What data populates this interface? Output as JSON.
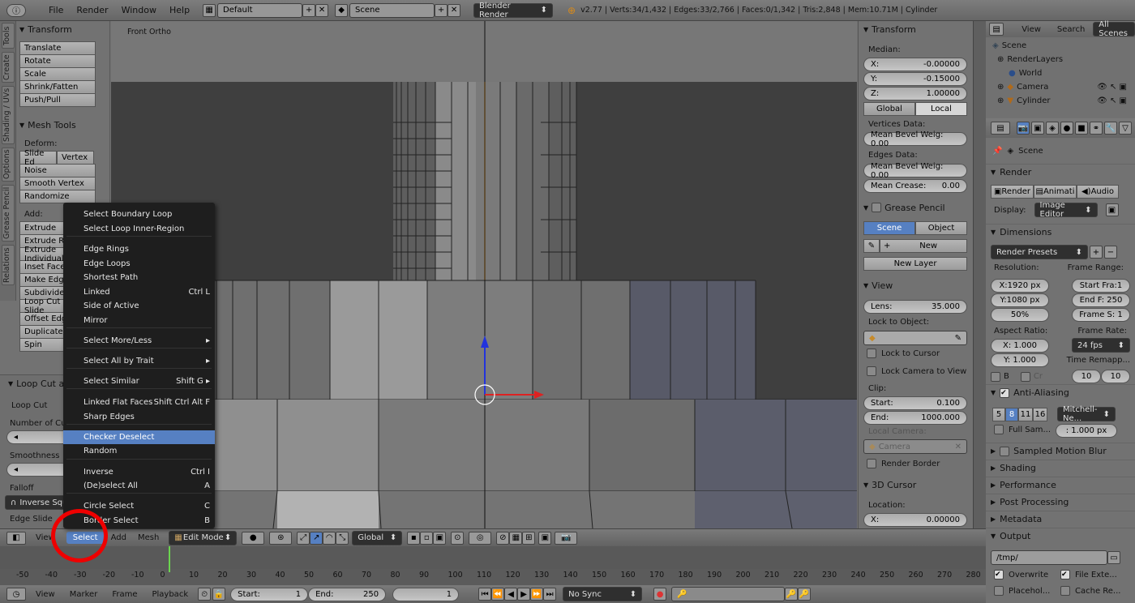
{
  "topbar": {
    "menus": [
      "File",
      "Render",
      "Window",
      "Help"
    ],
    "layout": "Default",
    "scene": "Scene",
    "engine": "Blender Render",
    "stats": "v2.77 | Verts:34/1,432 | Edges:33/2,766 | Faces:0/1,342 | Tris:2,848 | Mem:10.71M | Cylinder"
  },
  "toolshelf": {
    "tabs": [
      "Tools",
      "Create",
      "Shading / UVs",
      "Options",
      "Grease Pencil",
      "Relations"
    ],
    "transform": {
      "title": "Transform",
      "buttons": [
        "Translate",
        "Rotate",
        "Scale",
        "Shrink/Fatten",
        "Push/Pull"
      ]
    },
    "meshtools": {
      "title": "Mesh Tools",
      "deform": "Deform:",
      "slide_ed": "Slide Ed",
      "vertex": "Vertex",
      "noise": "Noise",
      "smooth": "Smooth Vertex",
      "randomize": "Randomize",
      "add": "Add:",
      "add_buttons": [
        "Extrude",
        "Extrude Region",
        "Extrude Individual",
        "Inset Faces",
        "Make Edge/Face",
        "Subdivide",
        "Loop Cut and Slide",
        "Offset Edge Slide",
        "Duplicate",
        "Spin"
      ]
    },
    "operator": {
      "title": "Loop Cut and Slide",
      "loop_cut": "Loop Cut",
      "number_of_cuts": "Number of Cuts",
      "smoothness": "Smoothness",
      "falloff": "Falloff",
      "falloff_value": "Inverse Square",
      "edge_slide": "Edge Slide"
    }
  },
  "viewport": {
    "label": "Front Ortho"
  },
  "context_menu": {
    "items": [
      {
        "label": "Select Boundary Loop",
        "shortcut": ""
      },
      {
        "label": "Select Loop Inner-Region",
        "shortcut": ""
      },
      {
        "label": "Edge Rings",
        "shortcut": ""
      },
      {
        "label": "Edge Loops",
        "shortcut": ""
      },
      {
        "label": "Shortest Path",
        "shortcut": ""
      },
      {
        "label": "Linked",
        "shortcut": "Ctrl L"
      },
      {
        "label": "Side of Active",
        "shortcut": ""
      },
      {
        "label": "Mirror",
        "shortcut": ""
      },
      {
        "label": "Select More/Less",
        "shortcut": "▸"
      },
      {
        "label": "Select All by Trait",
        "shortcut": "▸"
      },
      {
        "label": "Select Similar",
        "shortcut": "Shift G ▸"
      },
      {
        "label": "Linked Flat Faces",
        "shortcut": "Shift Ctrl Alt F"
      },
      {
        "label": "Sharp Edges",
        "shortcut": ""
      },
      {
        "label": "Checker Deselect",
        "shortcut": ""
      },
      {
        "label": "Random",
        "shortcut": ""
      },
      {
        "label": "Inverse",
        "shortcut": "Ctrl I"
      },
      {
        "label": "(De)select All",
        "shortcut": "A"
      },
      {
        "label": "Circle Select",
        "shortcut": "C"
      },
      {
        "label": "Border Select",
        "shortcut": "B"
      }
    ]
  },
  "npanel": {
    "transform": "Transform",
    "median": "Median:",
    "x_label": "X:",
    "x": "-0.00000",
    "y_label": "Y:",
    "y": "-0.15000",
    "z_label": "Z:",
    "z": "1.00000",
    "global": "Global",
    "local": "Local",
    "vertices_data": "Vertices Data:",
    "mean_bevel_v": "Mean Bevel Weig: 0.00",
    "edges_data": "Edges Data:",
    "mean_bevel_e": "Mean Bevel Weig: 0.00",
    "mean_crease_label": "Mean Crease:",
    "mean_crease": "0.00",
    "grease": "Grease Pencil",
    "scene": "Scene",
    "object": "Object",
    "new": "New",
    "new_layer": "New Layer",
    "view": "View",
    "lens_label": "Lens:",
    "lens": "35.000",
    "lock_to_object": "Lock to Object:",
    "lock_to_cursor": "Lock to Cursor",
    "lock_camera": "Lock Camera to View",
    "clip": "Clip:",
    "start_label": "Start:",
    "start": "0.100",
    "end_label": "End:",
    "end": "1000.000",
    "local_camera": "Local Camera:",
    "camera": "Camera",
    "render_border": "Render Border",
    "cursor": "3D Cursor",
    "location": "Location:",
    "cx_label": "X:",
    "cx": "0.00000"
  },
  "outliner": {
    "view": "View",
    "search": "Search",
    "all_scenes": "All Scenes",
    "items": [
      "Scene",
      "RenderLayers",
      "World",
      "Camera",
      "Cylinder"
    ]
  },
  "properties": {
    "scene": "Scene",
    "render": "Render",
    "render_btn": "Render",
    "anim_btn": "Animati",
    "audio_btn": "Audio",
    "display_label": "Display:",
    "display": "Image Editor",
    "dimensions": "Dimensions",
    "presets": "Render Presets",
    "resolution": "Resolution:",
    "frame_range": "Frame Range:",
    "resx": "X:1920 px",
    "resy": "Y:1080 px",
    "res_pct": "50%",
    "start_frame": "Start Fra:1",
    "end_frame": "End F: 250",
    "frame_step": "Frame S: 1",
    "aspect": "Aspect Ratio:",
    "framerate": "Frame Rate:",
    "ax": "X:   1.000",
    "ay": "Y:   1.000",
    "fps": "24 fps",
    "time_remap": "Time Remapp...",
    "remap_a": "10",
    "remap_b": "10",
    "b_label": "B",
    "cr_label": "Cr",
    "aa": "Anti-Aliasing",
    "aa_levels": [
      "5",
      "8",
      "11",
      "16"
    ],
    "filter": "Mitchell-Ne...",
    "full_sample": "Full Sam...",
    "px": ": 1.000 px",
    "smb": "Sampled Motion Blur",
    "shading": "Shading",
    "performance": "Performance",
    "post": "Post Processing",
    "metadata": "Metadata",
    "output": "Output",
    "path": "/tmp/",
    "overwrite": "Overwrite",
    "file_ext": "File Exte...",
    "placeholders": "Placehol...",
    "cache": "Cache Re..."
  },
  "viewhdr": {
    "view": "View",
    "select": "Select",
    "add": "Add",
    "mesh": "Mesh",
    "mode": "Edit Mode",
    "orientation": "Global"
  },
  "timeline": {
    "ticks": [
      "-50",
      "-40",
      "-30",
      "-20",
      "-10",
      "0",
      "10",
      "20",
      "30",
      "40",
      "50",
      "60",
      "70",
      "80",
      "90",
      "100",
      "110",
      "120",
      "130",
      "140",
      "150",
      "160",
      "170",
      "180",
      "190",
      "200",
      "210",
      "220",
      "230",
      "240",
      "250",
      "260",
      "270",
      "280"
    ],
    "current_frame": 1
  },
  "timehdr": {
    "view": "View",
    "marker": "Marker",
    "frame": "Frame",
    "playback": "Playback",
    "start": "Start:",
    "start_val": "1",
    "end": "End:",
    "end_val": "250",
    "current": "1",
    "sync": "No Sync"
  }
}
